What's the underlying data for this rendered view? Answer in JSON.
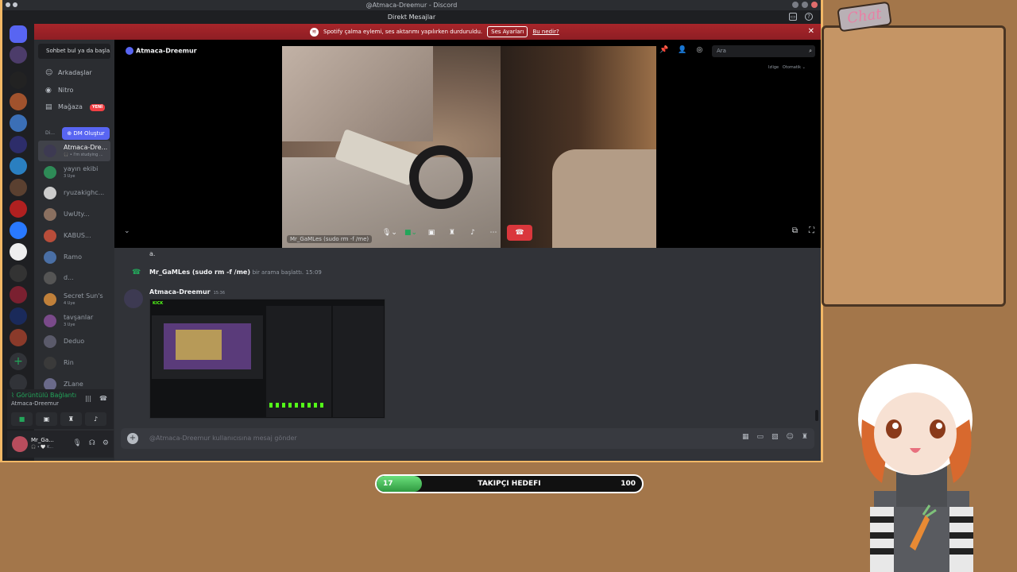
{
  "window": {
    "title": "@Atmaca-Dreemur - Discord",
    "section": "Direkt Mesajlar"
  },
  "notice": {
    "text": "Spotify çalma eylemi, ses aktarımı yapılırken durduruldu.",
    "button": "Ses Ayarları",
    "link": "Bu nedir?"
  },
  "sidebar": {
    "search_label": "Sohbet bul ya da başla...",
    "nav": [
      {
        "label": "Arkadaşlar",
        "icon": "friends-icon"
      },
      {
        "label": "Nitro",
        "icon": "nitro-icon"
      },
      {
        "label": "Mağaza",
        "icon": "shop-icon",
        "badge": "YENİ"
      }
    ],
    "dm_header": "Di...",
    "dm_create": "DM Oluştur",
    "dms": [
      {
        "name": "Atmaca-Dre...",
        "sub": "🎧 • I'm studying ...",
        "active": true,
        "color": "#3d3a52"
      },
      {
        "name": "yayın ekibi",
        "sub": "3 Üye",
        "color": "#2e8b57"
      },
      {
        "name": "ryuzakighc...",
        "sub": "",
        "color": "#cccccc"
      },
      {
        "name": "UwUty...",
        "sub": "",
        "color": "#8a7060"
      },
      {
        "name": "KABUS...",
        "sub": "",
        "color": "#b84d3a"
      },
      {
        "name": "Ramo",
        "sub": "",
        "color": "#4a6fa5"
      },
      {
        "name": "d...",
        "sub": "",
        "color": "#555555"
      },
      {
        "name": "Secret Sun's",
        "sub": "4 Üye",
        "color": "#c0803a"
      },
      {
        "name": "tavşanlar",
        "sub": "3 Üye",
        "color": "#7a4a8a"
      },
      {
        "name": "Deduo",
        "sub": "",
        "color": "#5a5a6a"
      },
      {
        "name": "Rin",
        "sub": "",
        "color": "#3a3a3a"
      },
      {
        "name": "ZLane",
        "sub": "",
        "color": "#6a6a8a"
      }
    ],
    "voice_status": "Görüntülü Bağlantı",
    "voice_user": "Atmaca-Dreemur",
    "user_name": "Mr_Ga...",
    "user_sub": "🎧 • 🤍 K..."
  },
  "call": {
    "channel": "Atmaca-Dreemur",
    "search_placeholder": "Ara",
    "meta_left": "Izlige",
    "meta_right": "Otomatik",
    "video_label": "Mr_GaMLes (sudo rm -f /me)"
  },
  "messages": {
    "prev_text": "a.",
    "call_user": "Mr_GaMLes (sudo rm -f /me)",
    "call_text": "bir arama başlattı.",
    "call_time": "15:09",
    "author": "Atmaca-Dreemur",
    "author_time": "15:36",
    "attach_label": "KICK"
  },
  "composer": {
    "placeholder": "@Atmaca-Dreemur kullanıcısına mesaj gönder"
  },
  "overlay": {
    "chat_title": "Chat",
    "follow_label": "TAKIPÇI HEDEFI",
    "follow_current": "17",
    "follow_goal": "100",
    "follow_fraction": 0.17
  },
  "colors": {
    "frame": "#f2b866",
    "background": "#a3764a",
    "accent": "#5865f2",
    "danger": "#da373c",
    "online": "#23a55a"
  }
}
